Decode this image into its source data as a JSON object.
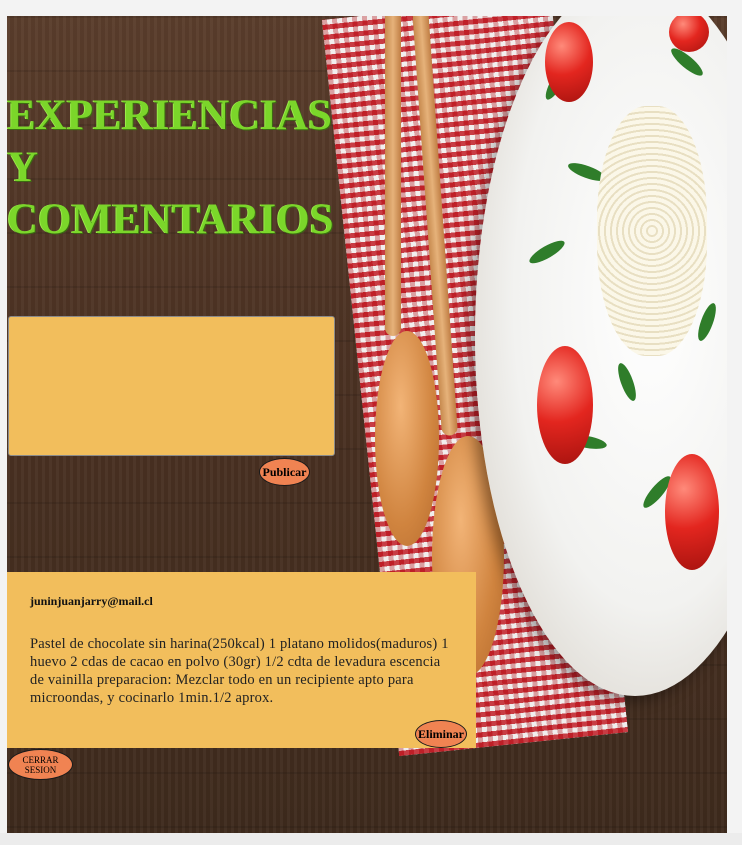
{
  "header": {
    "title": "EXPERIENCIAS Y COMENTARIOS"
  },
  "comment_form": {
    "textarea_value": "",
    "publish_label": "Publicar"
  },
  "comments": [
    {
      "author": "juninjuanjarry@mail.cl",
      "text": "Pastel de chocolate sin harina(250kcal) 1 platano molidos(maduros) 1 huevo 2 cdas de cacao en polvo (30gr) 1/2 cdta de levadura escencia de vainilla preparacion: Mezclar todo en un recipiente apto para microondas, y cocinarlo 1min.1/2 aprox.",
      "delete_label": "Eliminar"
    }
  ],
  "session": {
    "logout_label": "CERRAR SESION"
  },
  "colors": {
    "title": "#7bd62a",
    "panel": "#f2be5c",
    "button": "#f08352"
  }
}
